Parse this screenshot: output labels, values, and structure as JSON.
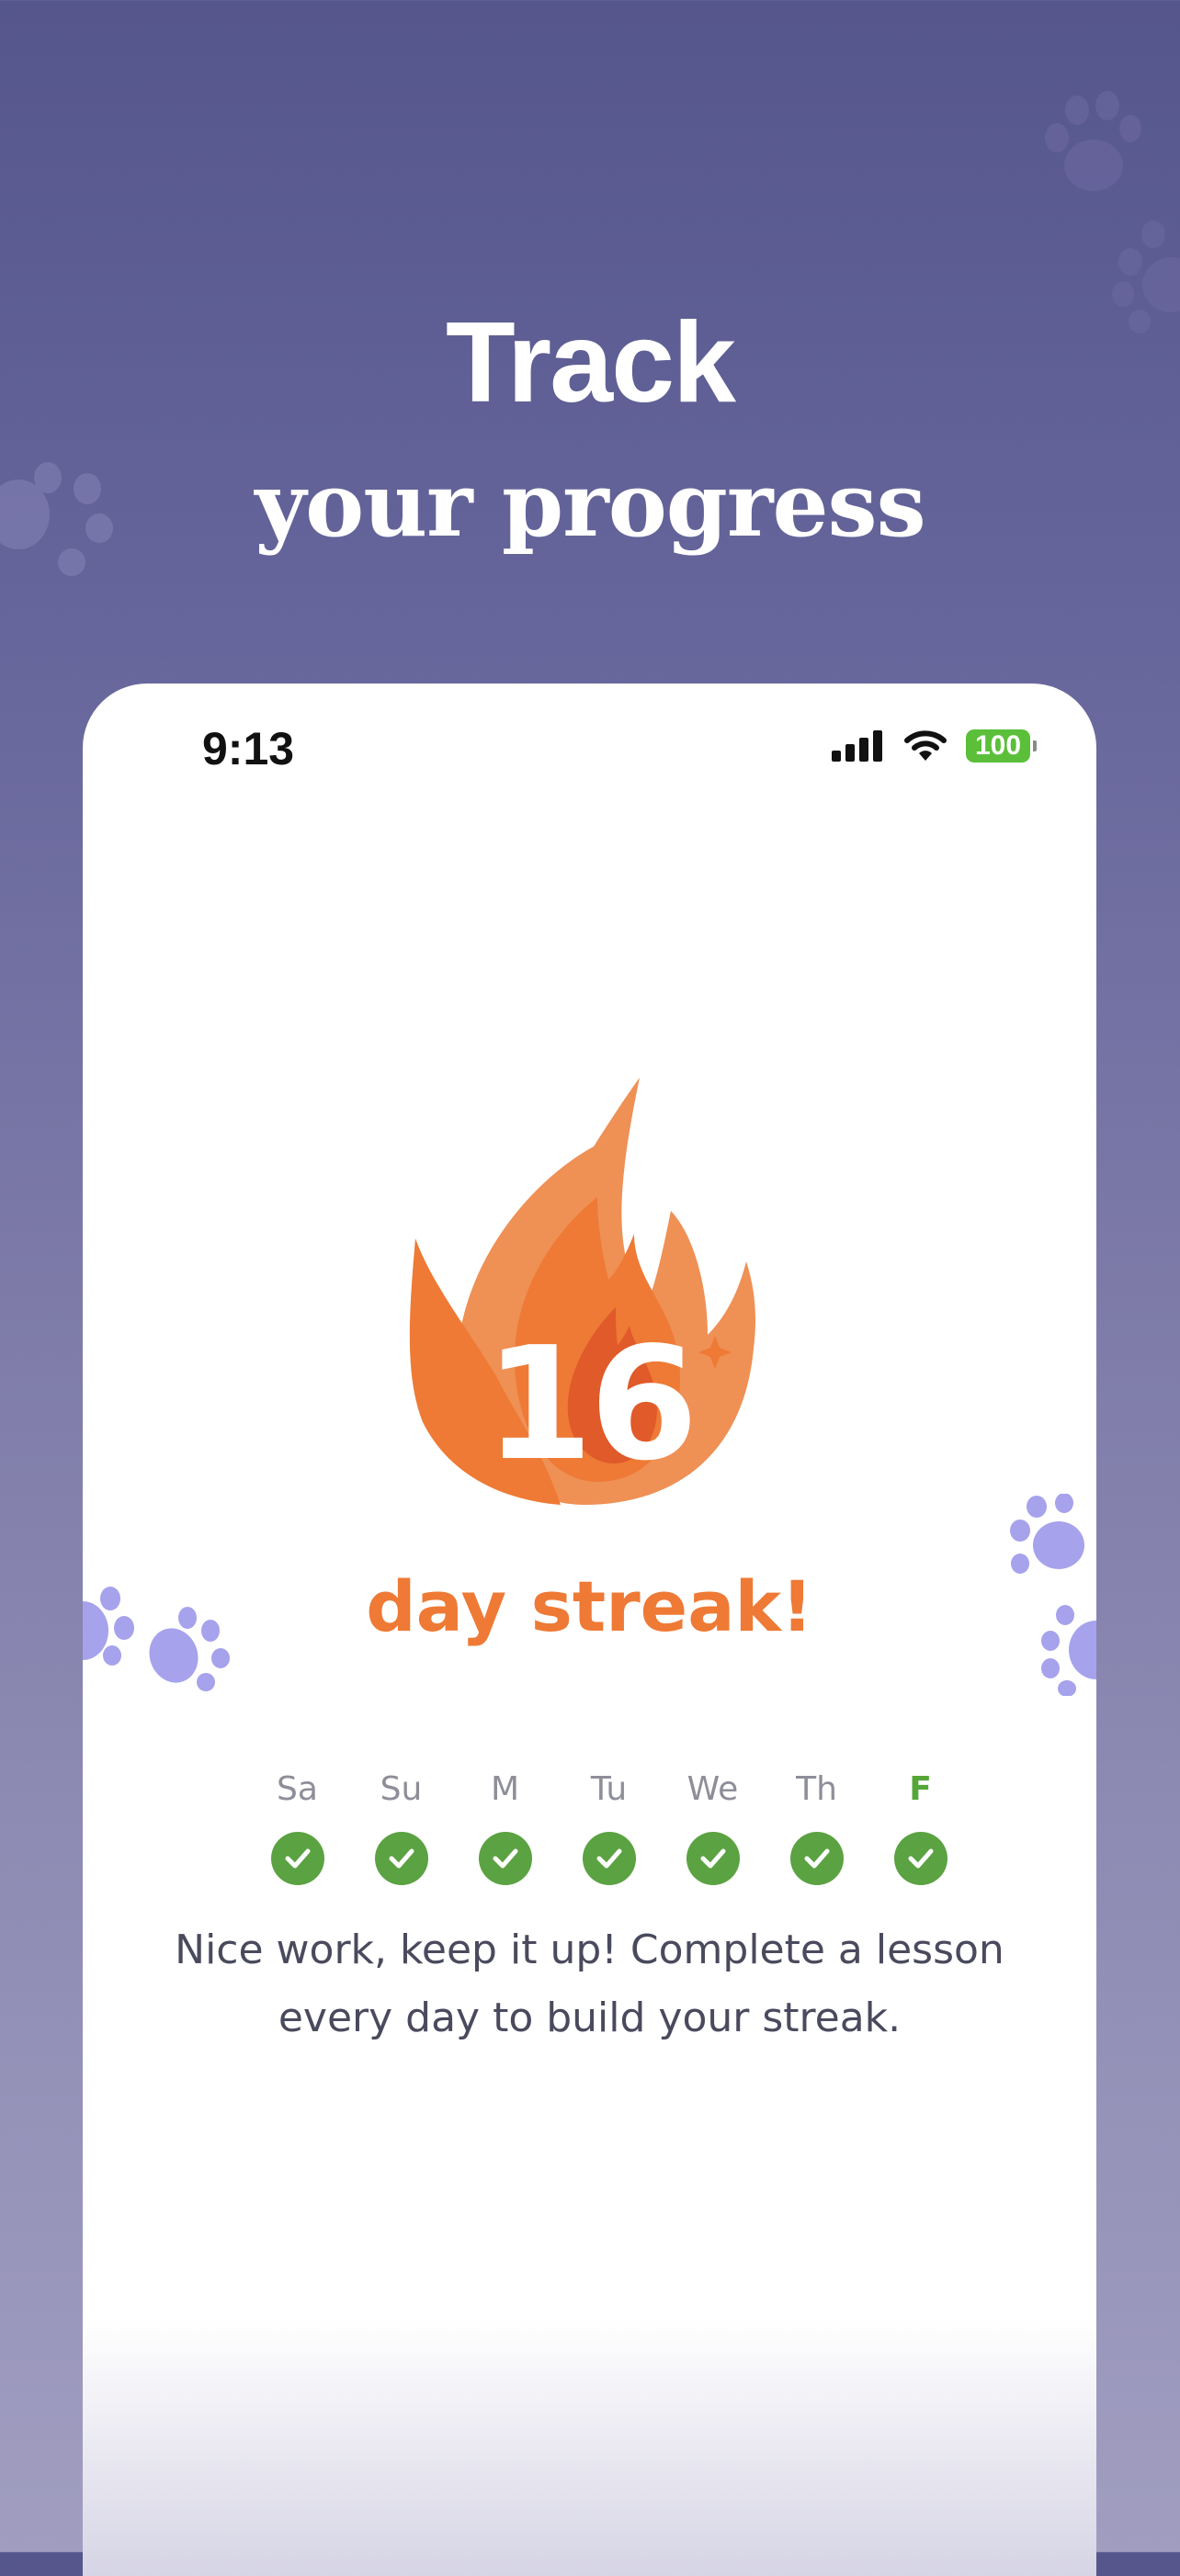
{
  "headline": {
    "line1": "Track",
    "line2": "your progress"
  },
  "status_bar": {
    "time": "9:13",
    "battery": "100"
  },
  "streak": {
    "count": "16",
    "label": "day streak!"
  },
  "week": [
    {
      "label": "Sa",
      "done": true
    },
    {
      "label": "Su",
      "done": true
    },
    {
      "label": "M",
      "done": true
    },
    {
      "label": "Tu",
      "done": true
    },
    {
      "label": "We",
      "done": true
    },
    {
      "label": "Th",
      "done": true
    },
    {
      "label": "F",
      "done": true,
      "today": true
    }
  ],
  "message": "Nice work, keep it up! Complete a lesson every day to build your streak.",
  "colors": {
    "background_top": "#55568c",
    "flame_light": "#ef9055",
    "flame_dark": "#e05a2a",
    "streak_orange": "#ee7a35",
    "check_green": "#5ba242",
    "paw_purple": "#a6a2ec",
    "battery_green": "#5bbf3a"
  }
}
